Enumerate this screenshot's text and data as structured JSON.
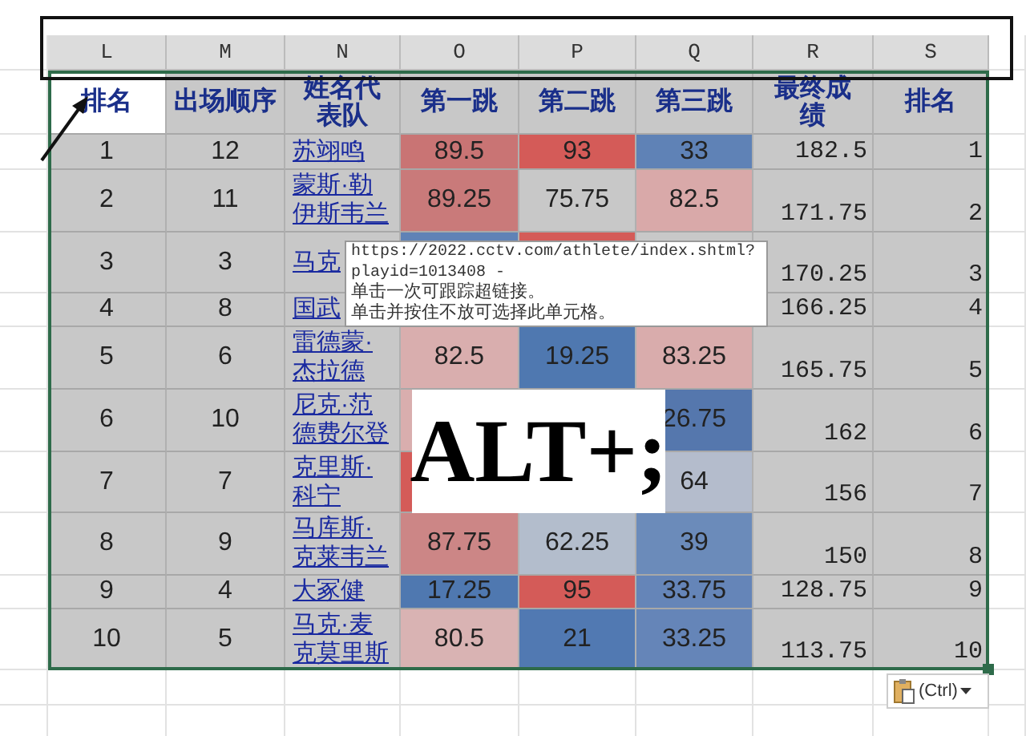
{
  "column_headers": [
    "L",
    "M",
    "N",
    "O",
    "P",
    "Q",
    "R",
    "S"
  ],
  "table": {
    "columns": [
      "排名",
      "出场顺序",
      "姓名代表队",
      "第一跳",
      "第二跳",
      "第三跳",
      "最终成绩",
      "排名"
    ],
    "rows": [
      {
        "rank": "1",
        "order": "12",
        "name": "苏翊鸣",
        "jump_1": {
          "value": "89.5",
          "color": "#c97474"
        },
        "jump_2": {
          "value": "93",
          "color": "#d45b58"
        },
        "jump_3": {
          "value": "33",
          "color": "#5f82b6"
        },
        "final": "182.5",
        "place": "1"
      },
      {
        "rank": "2",
        "order": "11",
        "name": "蒙斯·勒伊斯韦兰",
        "jump_1": {
          "value": "89.25",
          "color": "#c97a7a"
        },
        "jump_2": {
          "value": "75.75",
          "color": "#c8c8c8"
        },
        "jump_3": {
          "value": "82.5",
          "color": "#d9a9a9"
        },
        "final": "171.75",
        "place": "2"
      },
      {
        "rank": "3",
        "order": "3",
        "name": "马克",
        "jump_1": {
          "color": "#5f82b6"
        },
        "jump_2": {
          "color": "#d45b58"
        },
        "final": "170.25",
        "place": "3"
      },
      {
        "rank": "4",
        "order": "8",
        "name": "国武",
        "final": "166.25",
        "place": "4"
      },
      {
        "rank": "5",
        "order": "6",
        "name": "雷德蒙·杰拉德",
        "jump_1": {
          "value": "82.5",
          "color": "#d9aeae"
        },
        "jump_2": {
          "value": "19.25",
          "color": "#4f78b0"
        },
        "jump_3": {
          "value": "83.25",
          "color": "#d9acac"
        },
        "final": "165.75",
        "place": "5"
      },
      {
        "rank": "6",
        "order": "10",
        "name": "尼克·范德费尔登",
        "jump_1": {
          "color": "#d9aeae"
        },
        "jump_3": {
          "value": "26.75",
          "color": "#5577ad"
        },
        "final": "162",
        "place": "6"
      },
      {
        "rank": "7",
        "order": "7",
        "name": "克里斯·科宁",
        "jump_1": {
          "color": "#d45b58"
        },
        "jump_3": {
          "value": "64",
          "color": "#b4bccc"
        },
        "final": "156",
        "place": "7"
      },
      {
        "rank": "8",
        "order": "9",
        "name": "马库斯·克莱韦兰",
        "jump_1": {
          "value": "87.75",
          "color": "#cc8686"
        },
        "jump_2": {
          "value": "62.25",
          "color": "#b3bdcc"
        },
        "jump_3": {
          "value": "39",
          "color": "#6b8bba"
        },
        "final": "150",
        "place": "8"
      },
      {
        "rank": "9",
        "order": "4",
        "name": "大冢健",
        "jump_1": {
          "value": "17.25",
          "color": "#4f78b0"
        },
        "jump_2": {
          "value": "95",
          "color": "#d45b58"
        },
        "jump_3": {
          "value": "33.75",
          "color": "#6585b8"
        },
        "final": "128.75",
        "place": "9"
      },
      {
        "rank": "10",
        "order": "5",
        "name": "马克·麦克莫里斯",
        "jump_1": {
          "value": "80.5",
          "color": "#d9b3b3"
        },
        "jump_2": {
          "value": "21",
          "color": "#5179b2"
        },
        "jump_3": {
          "value": "33.25",
          "color": "#6585b8"
        },
        "final": "113.75",
        "place": "10"
      }
    ]
  },
  "tooltip": {
    "lines": [
      "https://2022.cctv.com/athlete/index.shtml?",
      "playid=1013408 -",
      "单击一次可跟踪超链接。",
      "单击并按住不放可选择此单元格。"
    ]
  },
  "caption": "ALT+;",
  "paste_button": {
    "label": "(Ctrl)"
  }
}
